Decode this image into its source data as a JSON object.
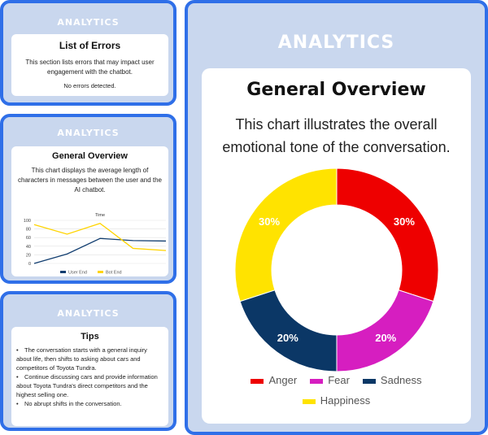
{
  "panels": {
    "errors": {
      "header": "ANALYTICS",
      "title": "List of Errors",
      "description": "This section lists errors that may impact user engagement with the chatbot.",
      "status": "No errors detected."
    },
    "length": {
      "header": "ANALYTICS",
      "title": "General Overview",
      "description": "This chart displays the average length of characters in messages between the user and the AI chatbot."
    },
    "tips": {
      "header": "ANALYTICS",
      "title": "Tips",
      "items": [
        "The conversation starts with a general inquiry about life, then shifts to asking about cars and competitors of Toyota Tundra.",
        "Continue discussing cars and provide information about Toyota Tundra's direct competitors and the highest selling one.",
        "No abrupt shifts in the conversation."
      ]
    },
    "overview": {
      "header": "ANALYTICS",
      "title": "General Overview",
      "description": "This chart illustrates the overall emotional tone of the conversation."
    }
  },
  "chart_data": [
    {
      "type": "line",
      "title": "Time",
      "x": [
        1,
        2,
        3,
        4,
        5
      ],
      "ylim": [
        0,
        100
      ],
      "yticks": [
        0,
        20,
        40,
        60,
        80,
        100
      ],
      "grid": true,
      "legend": "bottom",
      "series": [
        {
          "name": "User End",
          "color": "#123e70",
          "values": [
            0,
            22,
            58,
            53,
            52
          ]
        },
        {
          "name": "Bot End",
          "color": "#ffd400",
          "values": [
            90,
            68,
            93,
            35,
            30
          ]
        }
      ]
    },
    {
      "type": "pie",
      "categories": [
        "Anger",
        "Fear",
        "Sadness",
        "Happiness"
      ],
      "values": [
        30,
        20,
        20,
        30
      ],
      "labels": [
        "30%",
        "20%",
        "20%",
        "30%"
      ],
      "colors": [
        "#ee0000",
        "#d61ec0",
        "#0b3766",
        "#ffe300"
      ],
      "legend": "bottom"
    }
  ]
}
